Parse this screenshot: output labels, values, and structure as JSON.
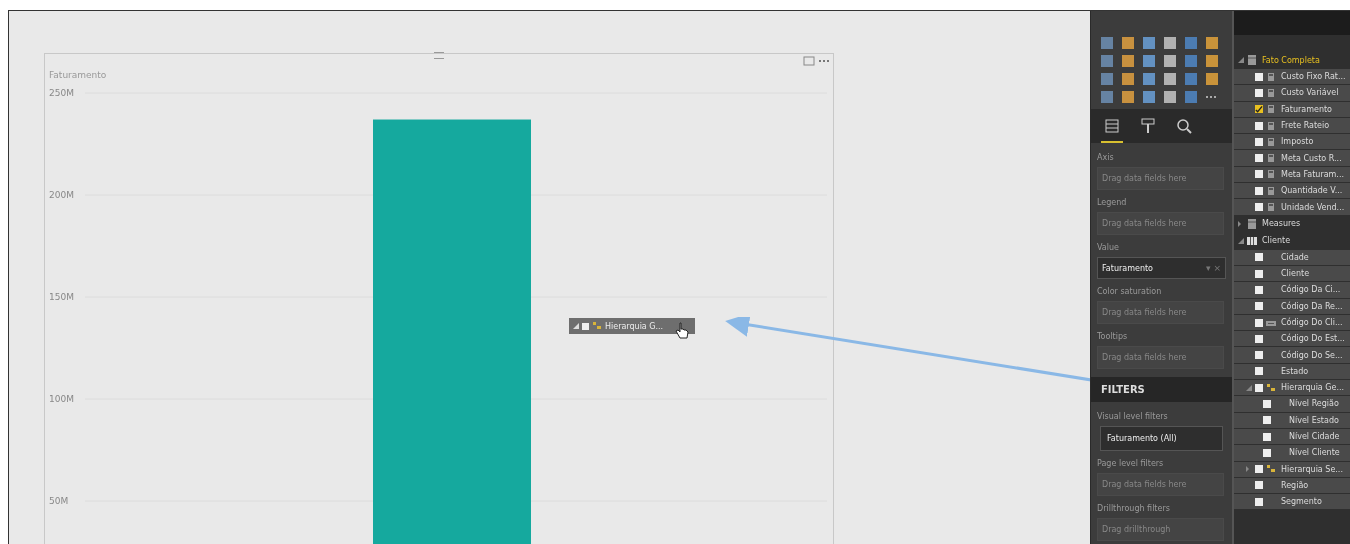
{
  "visual": {
    "title": "Faturamento",
    "chart_data": {
      "type": "bar",
      "values": [
        237000000
      ],
      "ylim": [
        0,
        250000000
      ],
      "grid": true,
      "yticks": [
        {
          "value": 50000000,
          "label": "50M"
        },
        {
          "value": 100000000,
          "label": "100M"
        },
        {
          "value": 150000000,
          "label": "150M"
        },
        {
          "value": 200000000,
          "label": "200M"
        },
        {
          "value": 250000000,
          "label": "250M"
        }
      ]
    }
  },
  "drag_chip": {
    "label": "Hierarquia G...",
    "checked": false
  },
  "visualizations": {
    "tabs": [
      {
        "kind": "fields",
        "selected": true
      },
      {
        "kind": "format",
        "selected": false
      },
      {
        "kind": "analytics",
        "selected": false
      }
    ],
    "wells": [
      {
        "label": "Axis",
        "placeholder": "Drag data fields here"
      },
      {
        "label": "Legend",
        "placeholder": "Drag data fields here"
      },
      {
        "label": "Value",
        "value": "Faturamento",
        "dropdown": "▾",
        "remove": "×"
      },
      {
        "label": "Color saturation",
        "placeholder": "Drag data fields here"
      },
      {
        "label": "Tooltips",
        "placeholder": "Drag data fields here"
      }
    ]
  },
  "filters": {
    "title": "FILTERS",
    "sections": [
      {
        "label": "Visual level filters",
        "value": "Faturamento (All)"
      },
      {
        "label": "Page level filters",
        "placeholder": "Drag data fields here"
      },
      {
        "label": "Drillthrough filters",
        "placeholder": "Drag drillthrough"
      }
    ]
  },
  "fields": [
    {
      "name": "Fato Completa",
      "kind": "table",
      "expanded": true,
      "highlighted": true,
      "children": [
        {
          "name": "Custo Fixo Rat...",
          "kind": "measure",
          "checked": false
        },
        {
          "name": "Custo Variável",
          "kind": "measure",
          "checked": false
        },
        {
          "name": "Faturamento",
          "kind": "measure",
          "checked": true
        },
        {
          "name": "Frete Rateio",
          "kind": "measure",
          "checked": false
        },
        {
          "name": "Imposto",
          "kind": "measure",
          "checked": false
        },
        {
          "name": "Meta Custo R...",
          "kind": "measure",
          "checked": false
        },
        {
          "name": "Meta Faturam...",
          "kind": "measure",
          "checked": false
        },
        {
          "name": "Quantidade V...",
          "kind": "measure",
          "checked": false
        },
        {
          "name": "Unidade Vend...",
          "kind": "measure",
          "checked": false
        }
      ]
    },
    {
      "name": "Measures",
      "kind": "table",
      "expanded": false,
      "highlighted": false
    },
    {
      "name": "Cliente",
      "kind": "grid",
      "expanded": true,
      "highlighted": false,
      "children": [
        {
          "name": "Cidade",
          "kind": "column",
          "checked": false
        },
        {
          "name": "Cliente",
          "kind": "column",
          "checked": false
        },
        {
          "name": "Código Da Ci...",
          "kind": "column",
          "checked": false
        },
        {
          "name": "Código Da Re...",
          "kind": "column",
          "checked": false
        },
        {
          "name": "Código Do Cli...",
          "kind": "key",
          "checked": false
        },
        {
          "name": "Código Do Est...",
          "kind": "column",
          "checked": false
        },
        {
          "name": "Código Do Se...",
          "kind": "column",
          "checked": false
        },
        {
          "name": "Estado",
          "kind": "column",
          "checked": false
        },
        {
          "name": "Hierarquia Ge...",
          "kind": "hierarchy",
          "checked": false,
          "expanded": true,
          "children": [
            {
              "name": "Nível Região",
              "kind": "column",
              "checked": false
            },
            {
              "name": "Nível Estado",
              "kind": "column",
              "checked": false
            },
            {
              "name": "Nível Cidade",
              "kind": "column",
              "checked": false
            },
            {
              "name": "Nível Cliente",
              "kind": "column",
              "checked": false
            }
          ]
        },
        {
          "name": "Hierarquia Se...",
          "kind": "hierarchy",
          "checked": false,
          "expanded": false
        },
        {
          "name": "Região",
          "kind": "column",
          "checked": false
        },
        {
          "name": "Segmento",
          "kind": "column",
          "checked": false
        }
      ]
    }
  ]
}
